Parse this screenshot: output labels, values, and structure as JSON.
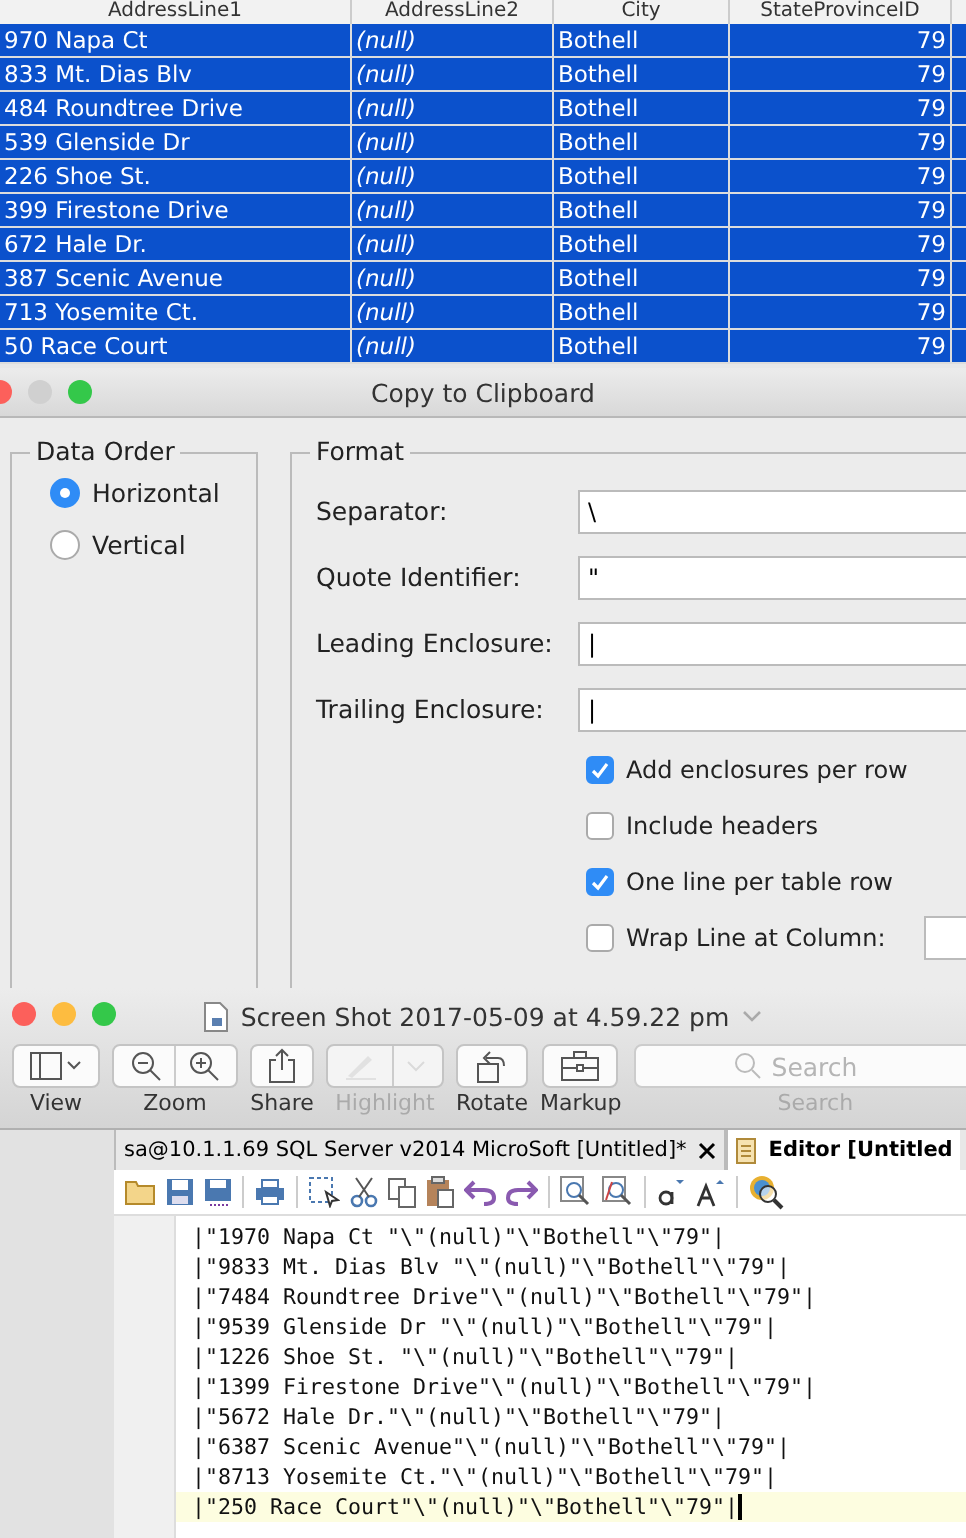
{
  "table": {
    "columns": [
      "AddressLine1",
      "AddressLine2",
      "City",
      "StateProvinceID"
    ],
    "rows": [
      {
        "cells": [
          "970 Napa Ct",
          "(null)",
          "Bothell",
          "79"
        ],
        "selected": true
      },
      {
        "cells": [
          "833 Mt. Dias Blv",
          "(null)",
          "Bothell",
          "79"
        ],
        "selected": true
      },
      {
        "cells": [
          "484 Roundtree Drive",
          "(null)",
          "Bothell",
          "79"
        ],
        "selected": true
      },
      {
        "cells": [
          "539 Glenside Dr",
          "(null)",
          "Bothell",
          "79"
        ],
        "selected": true
      },
      {
        "cells": [
          "226 Shoe St.",
          "(null)",
          "Bothell",
          "79"
        ],
        "selected": true
      },
      {
        "cells": [
          "399 Firestone Drive",
          "(null)",
          "Bothell",
          "79"
        ],
        "selected": true
      },
      {
        "cells": [
          "672 Hale Dr.",
          "(null)",
          "Bothell",
          "79"
        ],
        "selected": true
      },
      {
        "cells": [
          "387 Scenic Avenue",
          "(null)",
          "Bothell",
          "79"
        ],
        "selected": true
      },
      {
        "cells": [
          "713 Yosemite Ct.",
          "(null)",
          "Bothell",
          "79"
        ],
        "selected": true
      },
      {
        "cells": [
          "50 Race Court",
          "(null)",
          "Bothell",
          "79"
        ],
        "selected": true
      }
    ]
  },
  "dialog": {
    "title": "Copy to Clipboard",
    "data_order": {
      "label": "Data Order",
      "options": [
        {
          "label": "Horizontal",
          "selected": true
        },
        {
          "label": "Vertical",
          "selected": false
        }
      ]
    },
    "format": {
      "label": "Format",
      "fields": [
        {
          "label": "Separator:",
          "value": "\\"
        },
        {
          "label": "Quote Identifier:",
          "value": "\""
        },
        {
          "label": "Leading Enclosure:",
          "value": "|"
        },
        {
          "label": "Trailing Enclosure:",
          "value": "|"
        }
      ],
      "checkboxes": [
        {
          "label": "Add enclosures per row",
          "checked": true
        },
        {
          "label": "Include headers",
          "checked": false
        },
        {
          "label": "One line per table row",
          "checked": true
        },
        {
          "label": "Wrap Line at Column:",
          "checked": false
        }
      ]
    }
  },
  "preview": {
    "title": "Screen Shot 2017-05-09 at 4.59.22 pm",
    "toolbar": [
      {
        "label": "View",
        "disabled": false
      },
      {
        "label": "Zoom",
        "disabled": false
      },
      {
        "label": "Share",
        "disabled": false
      },
      {
        "label": "Highlight",
        "disabled": true
      },
      {
        "label": "Rotate",
        "disabled": false
      },
      {
        "label": "Markup",
        "disabled": false
      }
    ],
    "search": {
      "placeholder": "Search",
      "label": "Search"
    }
  },
  "editor": {
    "tabs": [
      {
        "label": "sa@10.1.1.69 SQL Server v2014 MicroSoft [Untitled]*",
        "selected": false
      },
      {
        "label": "Editor [Untitled",
        "selected": true
      }
    ],
    "lines": [
      {
        "text": "|\"1970 Napa Ct \"\\\"(null)\"\\\"Bothell\"\\\"79\"|",
        "current": false
      },
      {
        "text": "|\"9833 Mt. Dias Blv \"\\\"(null)\"\\\"Bothell\"\\\"79\"|",
        "current": false
      },
      {
        "text": "|\"7484 Roundtree Drive\"\\\"(null)\"\\\"Bothell\"\\\"79\"|",
        "current": false
      },
      {
        "text": "|\"9539 Glenside Dr \"\\\"(null)\"\\\"Bothell\"\\\"79\"|",
        "current": false
      },
      {
        "text": "|\"1226 Shoe St. \"\\\"(null)\"\\\"Bothell\"\\\"79\"|",
        "current": false
      },
      {
        "text": "|\"1399 Firestone Drive\"\\\"(null)\"\\\"Bothell\"\\\"79\"|",
        "current": false
      },
      {
        "text": "|\"5672 Hale Dr.\"\\\"(null)\"\\\"Bothell\"\\\"79\"|",
        "current": false
      },
      {
        "text": "|\"6387 Scenic Avenue\"\\\"(null)\"\\\"Bothell\"\\\"79\"|",
        "current": false
      },
      {
        "text": "|\"8713 Yosemite Ct.\"\\\"(null)\"\\\"Bothell\"\\\"79\"|",
        "current": false
      },
      {
        "text": "|\"250 Race Court\"\\\"(null)\"\\\"Bothell\"\\\"79\"|",
        "current": true
      }
    ]
  }
}
